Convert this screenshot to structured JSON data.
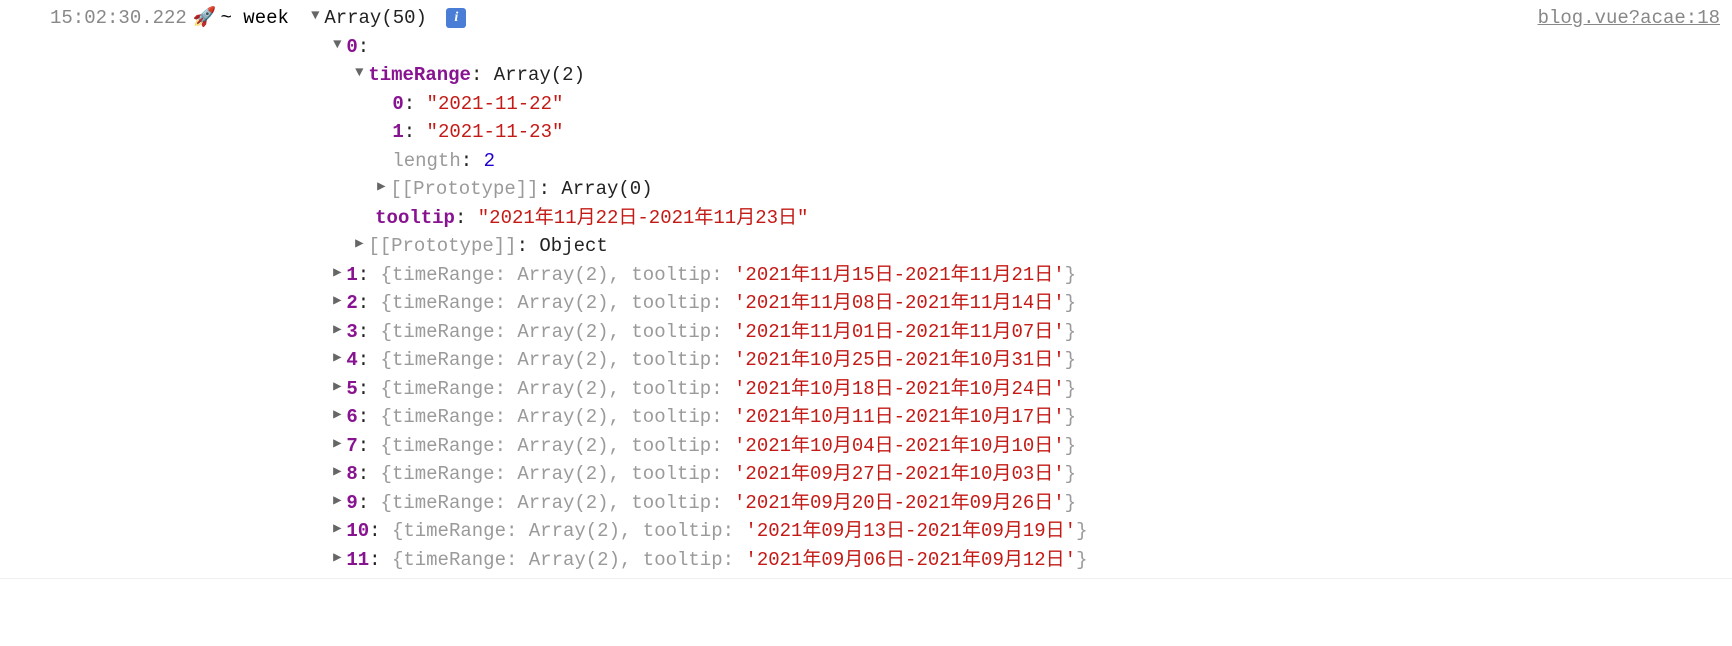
{
  "timestamp": "15:02:30.222",
  "rocket": "🚀",
  "prefix": "~ week",
  "arraySummary": "Array(50)",
  "infoGlyph": "i",
  "sourceLink": "blog.vue?acae:18",
  "expanded": {
    "index0Label": "0",
    "timeRangeKey": "timeRange",
    "timeRangeSummary": "Array(2)",
    "items": [
      {
        "key": "0",
        "value": "\"2021-11-22\""
      },
      {
        "key": "1",
        "value": "\"2021-11-23\""
      }
    ],
    "lengthKey": "length",
    "lengthVal": "2",
    "protoArrLabel": "[[Prototype]]",
    "protoArrSummary": "Array(0)",
    "tooltipKey": "tooltip",
    "tooltipVal": "\"2021年11月22日-2021年11月23日\"",
    "protoObjLabel": "[[Prototype]]",
    "protoObjSummary": "Object"
  },
  "rows": [
    {
      "idx": "1",
      "summary1": "{timeRange: Array(2), tooltip:",
      "tooltip": "'2021年11月15日-2021年11月21日'",
      "close": "}"
    },
    {
      "idx": "2",
      "summary1": "{timeRange: Array(2), tooltip:",
      "tooltip": "'2021年11月08日-2021年11月14日'",
      "close": "}"
    },
    {
      "idx": "3",
      "summary1": "{timeRange: Array(2), tooltip:",
      "tooltip": "'2021年11月01日-2021年11月07日'",
      "close": "}"
    },
    {
      "idx": "4",
      "summary1": "{timeRange: Array(2), tooltip:",
      "tooltip": "'2021年10月25日-2021年10月31日'",
      "close": "}"
    },
    {
      "idx": "5",
      "summary1": "{timeRange: Array(2), tooltip:",
      "tooltip": "'2021年10月18日-2021年10月24日'",
      "close": "}"
    },
    {
      "idx": "6",
      "summary1": "{timeRange: Array(2), tooltip:",
      "tooltip": "'2021年10月11日-2021年10月17日'",
      "close": "}"
    },
    {
      "idx": "7",
      "summary1": "{timeRange: Array(2), tooltip:",
      "tooltip": "'2021年10月04日-2021年10月10日'",
      "close": "}"
    },
    {
      "idx": "8",
      "summary1": "{timeRange: Array(2), tooltip:",
      "tooltip": "'2021年09月27日-2021年10月03日'",
      "close": "}"
    },
    {
      "idx": "9",
      "summary1": "{timeRange: Array(2), tooltip:",
      "tooltip": "'2021年09月20日-2021年09月26日'",
      "close": "}"
    },
    {
      "idx": "10",
      "summary1": "{timeRange: Array(2), tooltip:",
      "tooltip": "'2021年09月13日-2021年09月19日'",
      "close": "}"
    },
    {
      "idx": "11",
      "summary1": "{timeRange: Array(2), tooltip:",
      "tooltip": "'2021年09月06日-2021年09月12日'",
      "close": "}"
    }
  ]
}
